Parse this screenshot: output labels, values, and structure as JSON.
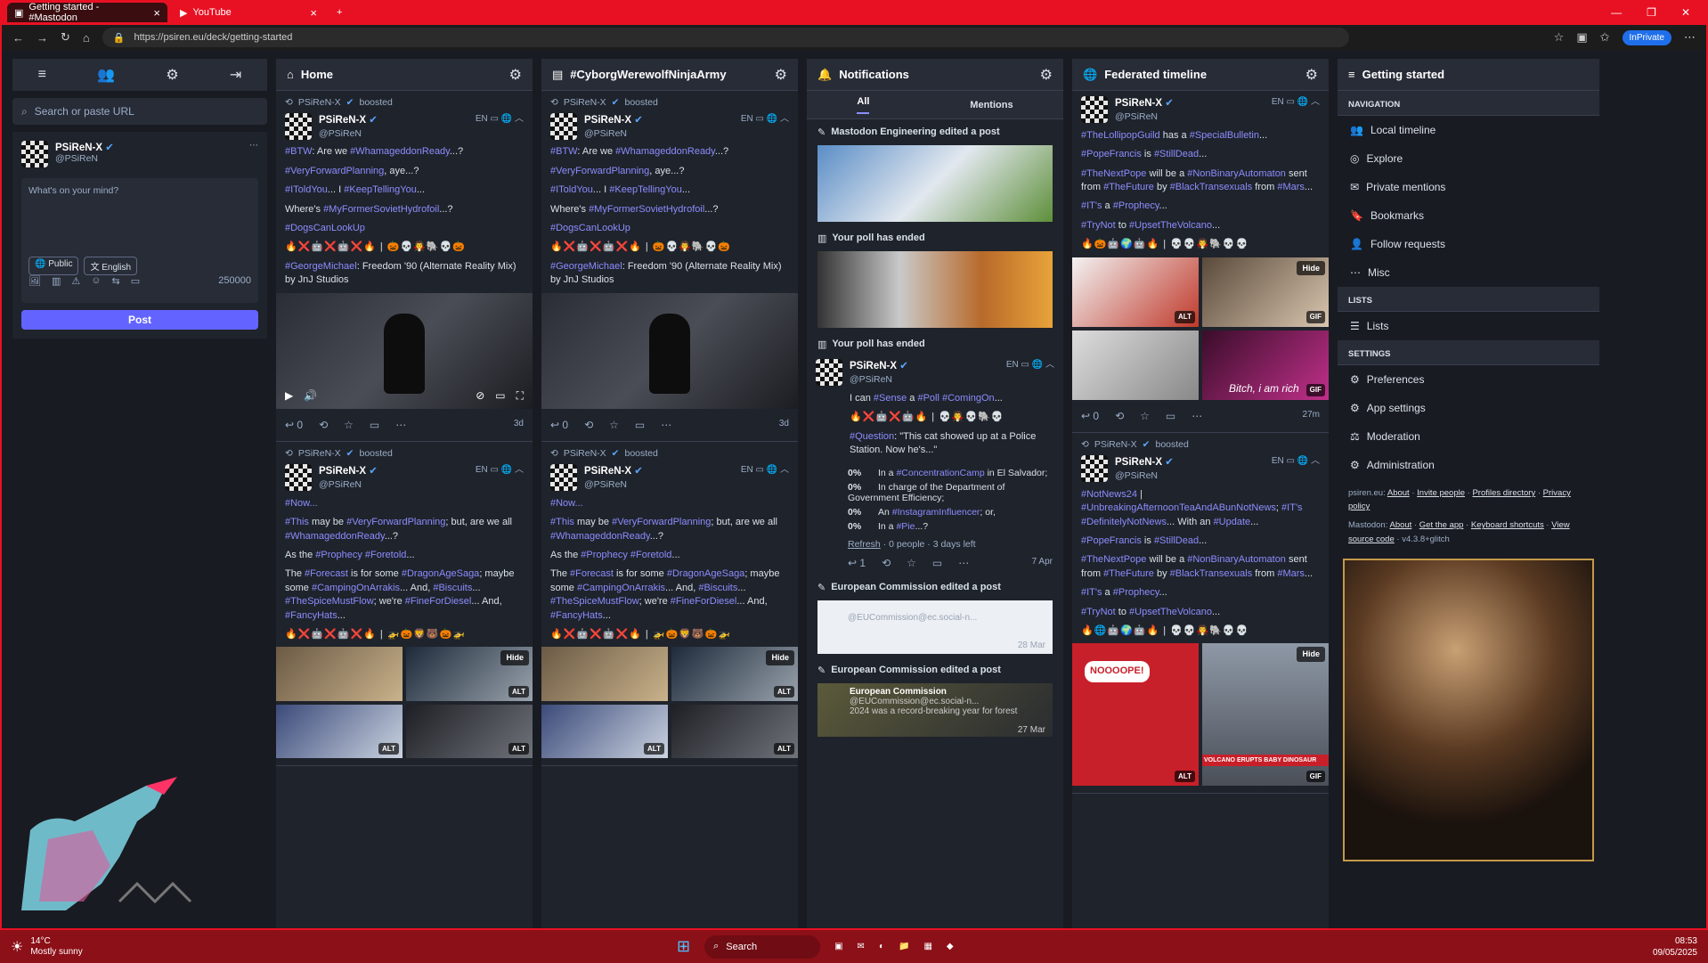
{
  "browser": {
    "tabs": [
      {
        "label": "Getting started - #Mastodon"
      },
      {
        "label": "YouTube"
      }
    ],
    "url": "https://psiren.eu/deck/getting-started",
    "inprivate": "InPrivate"
  },
  "left": {
    "search_placeholder": "Search or paste URL",
    "user": {
      "name": "PSiReN-X",
      "handle": "@PSiReN"
    },
    "compose": {
      "placeholder": "What's on your mind?",
      "visibility": "Public",
      "language": "English",
      "count": "250000",
      "post_label": "Post"
    }
  },
  "home": {
    "title": "Home",
    "post1": {
      "boost": "PSiReN-X",
      "boosted": "boosted",
      "name": "PSiReN-X",
      "handle": "@PSiReN",
      "lang": "EN",
      "l1a": "#BTW",
      "l1b": ": Are we ",
      "l1c": "#WhamageddonReady",
      "l1d": "...?",
      "l2a": "#VeryForwardPlanning",
      "l2b": ", aye...?",
      "l3a": "#IToldYou",
      "l3b": "... I ",
      "l3c": "#KeepTellingYou",
      "l3d": "...",
      "l4a": "Where's ",
      "l4b": "#MyFormerSovietHydrofoil",
      "l4c": "...?",
      "l5": "#DogsCanLookUp",
      "emoji": "🔥❌🤖❌🤖❌🔥 | 🎃💀🧛🐘💀🎃",
      "l6a": "#GeorgeMichael",
      "l6b": ": Freedom '90 (Alternate Reality Mix) by JnJ Studios",
      "replies": "0",
      "time": "3d"
    },
    "post2": {
      "boost": "PSiReN-X",
      "boosted": "boosted",
      "name": "PSiReN-X",
      "handle": "@PSiReN",
      "lang": "EN",
      "l1": "#Now...",
      "l2a": "#This",
      "l2b": " may be ",
      "l2c": "#VeryForwardPlanning",
      "l2d": "; but, are we all ",
      "l2e": "#WhamageddonReady",
      "l2f": "...?",
      "l3a": "As the ",
      "l3b": "#Prophecy",
      "l3c": " ",
      "l3d": "#Foretold",
      "l3e": "...",
      "l4a": "The ",
      "l4b": "#Forecast",
      "l4c": " is for some ",
      "l4d": "#DragonAgeSaga",
      "l4e": "; maybe some ",
      "l4f": "#CampingOnArrakis",
      "l4g": "... And, ",
      "l4h": "#Biscuits",
      "l4i": "... ",
      "l4j": "#TheSpiceMustFlow",
      "l4k": "; we're ",
      "l4l": "#FineForDiesel",
      "l4m": "... And, ",
      "l4n": "#FancyHats",
      "l4o": "...",
      "emoji": "🔥❌🤖❌🤖❌🔥 | 🚁🎃🦁🐻🎃🚁",
      "hide": "Hide",
      "alt": "ALT"
    }
  },
  "cyborg": {
    "title": "#CyborgWerewolfNinjaArmy"
  },
  "notifications": {
    "title": "Notifications",
    "tab_all": "All",
    "tab_mentions": "Mentions",
    "n1": "Mastodon Engineering edited a post",
    "n2": "Your poll has ended",
    "n3": "Your poll has ended",
    "poll_post": {
      "name": "PSiReN-X",
      "handle": "@PSiReN",
      "lang": "EN",
      "l1a": "I can ",
      "l1b": "#Sense",
      "l1c": " a ",
      "l1d": "#Poll",
      "l1e": " ",
      "l1f": "#ComingOn",
      "l1g": "...",
      "emoji": "🔥❌🤖❌🤖🔥 | 💀🧛💀🐘💀",
      "q1": "#Question",
      "q2": ": \"This cat showed up at a Police Station. Now he's...\"",
      "opts": [
        {
          "pct": "0%",
          "a": "In a ",
          "b": "#ConcentrationCamp",
          "c": " in El Salvador;"
        },
        {
          "pct": "0%",
          "a": "In charge of the Department of Government Efficiency;",
          "b": "",
          "c": ""
        },
        {
          "pct": "0%",
          "a": "An ",
          "b": "#InstagramInfluencer",
          "c": "; or,"
        },
        {
          "pct": "0%",
          "a": "In a ",
          "b": "#Pie",
          "c": "...?"
        }
      ],
      "refresh": "Refresh",
      "stats": " · 0 people · 3 days left",
      "replies": "1",
      "time": "7 Apr"
    },
    "n4": "European Commission edited a post",
    "n4_handle": "@EUCommission@ec.social-n...",
    "n4_time": "28 Mar",
    "n5": "European Commission edited a post",
    "n5_name": "European Commission",
    "n5_handle": "@EUCommission@ec.social-n...",
    "n5_text": "2024 was a record-breaking year for forest",
    "n5_time": "27 Mar"
  },
  "federated": {
    "title": "Federated timeline",
    "p1": {
      "name": "PSiReN-X",
      "handle": "@PSiReN",
      "lang": "EN",
      "l1a": "#TheLollipopGuild",
      "l1b": " has a ",
      "l1c": "#SpecialBulletin",
      "l1d": "...",
      "l2a": "#PopeFrancis",
      "l2b": " is ",
      "l2c": "#StillDead",
      "l2d": "...",
      "l3a": "#TheNextPope",
      "l3b": " will be a ",
      "l3c": "#NonBinaryAutomaton",
      "l3d": " sent from ",
      "l3e": "#TheFuture",
      "l3f": " by ",
      "l3g": "#BlackTransexuals",
      "l3h": " from ",
      "l3i": "#Mars",
      "l3j": "...",
      "l4a": "#IT's",
      "l4b": " a ",
      "l4c": "#Prophecy",
      "l4d": "...",
      "l5a": "#TryNot",
      "l5b": " to ",
      "l5c": "#UpsetTheVolcano",
      "l5d": "...",
      "emoji": "🔥🎃🤖🌍🤖🔥 | 💀💀🧛🐘💀💀",
      "hide": "Hide",
      "alt": "ALT",
      "gif": "GIF",
      "caption": "Bitch, i am rich",
      "replies": "0",
      "time": "27m"
    },
    "p2": {
      "boost": "PSiReN-X",
      "boosted": "boosted",
      "name": "PSiReN-X",
      "handle": "@PSiReN",
      "lang": "EN",
      "l1a": "#NotNews24",
      "l1b": " | ",
      "l1c": "#UnbreakingAfternoonTeaAndABunNotNews",
      "l1d": "; ",
      "l1e": "#IT's",
      "l1f": " ",
      "l1g": "#DefinitelyNotNews",
      "l1h": "... With an ",
      "l1i": "#Update",
      "l1j": "...",
      "l2a": "#PopeFrancis",
      "l2b": " is ",
      "l2c": "#StillDead",
      "l2d": "...",
      "l3a": "#TheNextPope",
      "l3b": " will be a ",
      "l3c": "#NonBinaryAutomaton",
      "l3d": " sent from ",
      "l3e": "#TheFuture",
      "l3f": " by ",
      "l3g": "#BlackTransexuals",
      "l3h": " from ",
      "l3i": "#Mars",
      "l3j": "...",
      "l4a": "#IT's",
      "l4b": " a ",
      "l4c": "#Prophecy",
      "l4d": "...",
      "l5a": "#TryNot",
      "l5b": " to ",
      "l5c": "#UpsetTheVolcano",
      "l5d": "...",
      "emoji": "🔥🌐🤖🌍🤖🔥 | 💀💀🧛🐘💀💀",
      "comic": "NOOOOPE!",
      "hide": "Hide",
      "alt": "ALT",
      "gif": "GIF",
      "volcano": "VOLCANO ERUPTS BABY DINOSAUR"
    }
  },
  "getting_started": {
    "title": "Getting started",
    "navigation": "NAVIGATION",
    "nav_items": [
      "Local timeline",
      "Explore",
      "Private mentions",
      "Bookmarks",
      "Follow requests",
      "Misc"
    ],
    "lists": "LISTS",
    "lists_item": "Lists",
    "settings": "SETTINGS",
    "settings_items": [
      "Preferences",
      "App settings",
      "Moderation",
      "Administration"
    ],
    "footer1": {
      "site": "psiren.eu:",
      "links": [
        "About",
        "Invite people",
        "Profiles directory",
        "Privacy policy"
      ]
    },
    "footer2": {
      "site": "Mastodon:",
      "links": [
        "About",
        "Get the app",
        "Keyboard shortcuts",
        "View source code"
      ],
      "version": "v4.3.8+glitch"
    }
  },
  "taskbar": {
    "temp": "14°C",
    "weather": "Mostly sunny",
    "search": "Search",
    "time": "08:53",
    "date": "09/05/2025"
  },
  "colors": {
    "accent": "#6364ff",
    "hashtag": "#8c8dff",
    "browser_frame": "#e81123"
  }
}
